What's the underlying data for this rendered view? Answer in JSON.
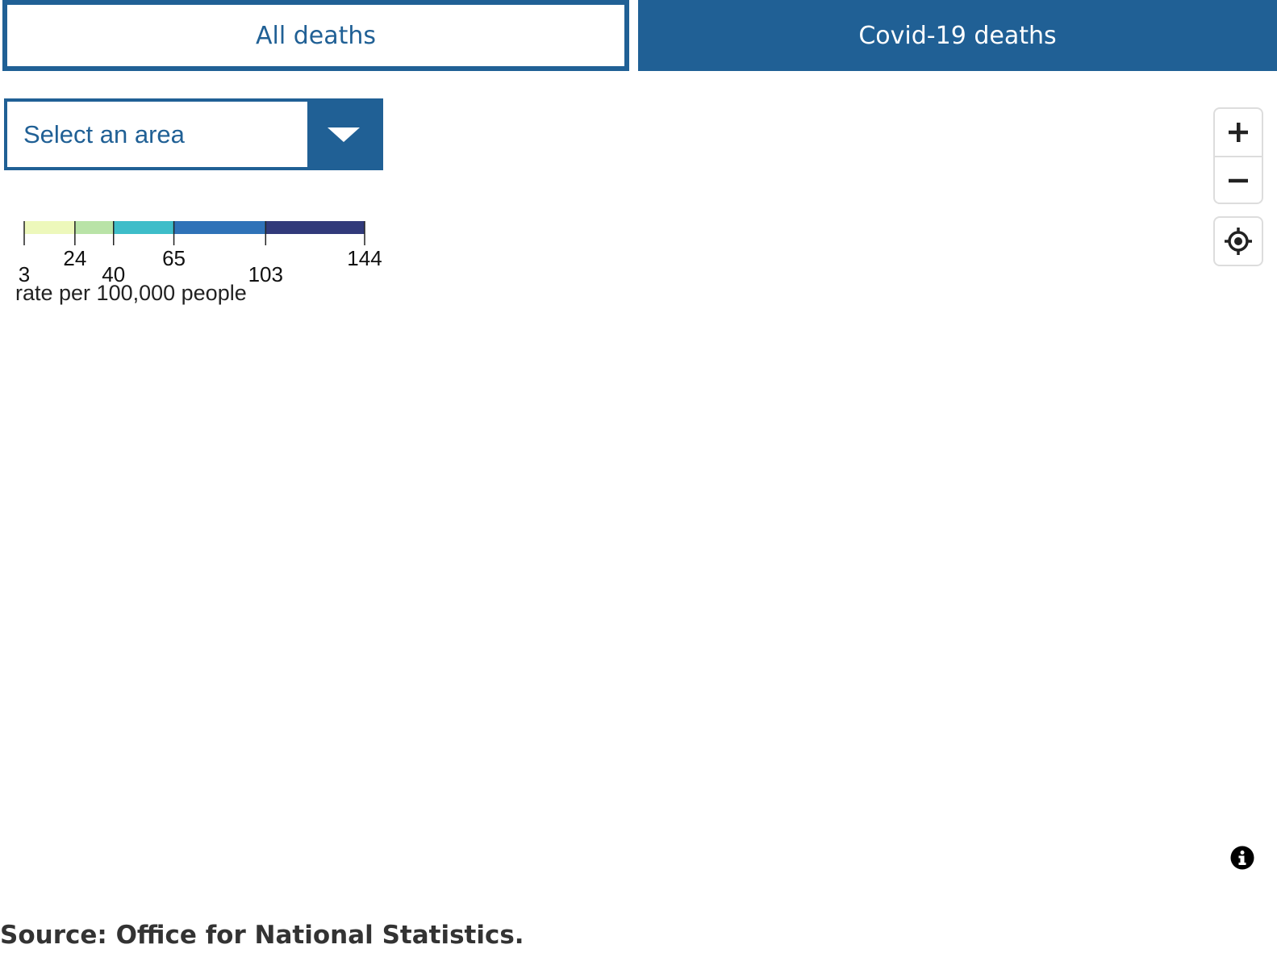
{
  "tabs": [
    {
      "label": "All deaths",
      "selected": true
    },
    {
      "label": "Covid-19 deaths",
      "selected": false
    }
  ],
  "area_select": {
    "placeholder": "Select an area",
    "icon": "chevron-down-icon"
  },
  "legend": {
    "breaks": [
      3,
      24,
      40,
      65,
      103,
      144
    ],
    "colors": [
      "#edf8bb",
      "#b9e3a7",
      "#3ebdc9",
      "#2f72b8",
      "#313a7a"
    ],
    "label": "rate per 100,000 people"
  },
  "map_controls": {
    "zoom_in_icon": "plus-icon",
    "zoom_out_icon": "minus-icon",
    "locate_icon": "crosshair-icon",
    "info_icon": "info-icon"
  },
  "source": "Source: Office for National Statistics.",
  "colors": {
    "brand_blue": "#206095"
  }
}
